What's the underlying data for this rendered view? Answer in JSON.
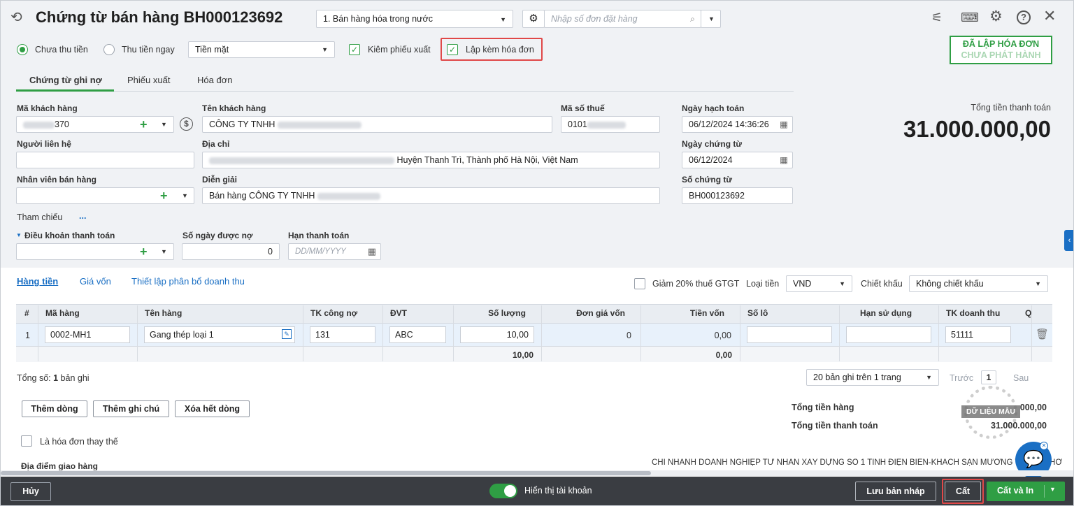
{
  "header": {
    "title": "Chứng từ bán hàng BH000123692",
    "type_select": "1. Bán hàng hóa trong nước",
    "order_placeholder": "Nhập số đơn đặt hàng"
  },
  "options": {
    "radio_unpaid": "Chưa thu tiền",
    "radio_paid": "Thu tiền ngay",
    "payment_method": "Tiền mặt",
    "chk_export": "Kiêm phiếu xuất",
    "chk_invoice": "Lập kèm hóa đơn"
  },
  "stamp": {
    "line1": "ĐÃ LẬP HÓA ĐƠN",
    "line2": "CHƯA PHÁT HÀNH"
  },
  "tabs": [
    "Chứng từ ghi nợ",
    "Phiếu xuất",
    "Hóa đơn"
  ],
  "form": {
    "customer_code_label": "Mã khách hàng",
    "customer_code_value": "370",
    "customer_name_label": "Tên khách hàng",
    "customer_name_value": "CÔNG TY TNHH",
    "tax_code_label": "Mã số thuế",
    "tax_code_value": "0101",
    "contact_label": "Người liên hệ",
    "address_label": "Địa chỉ",
    "address_value": "Huyện Thanh Trì, Thành phố Hà Nội, Việt Nam",
    "sales_staff_label": "Nhân viên bán hàng",
    "description_label": "Diễn giải",
    "description_value": "Bán hàng CÔNG TY TNHH",
    "reference_label": "Tham chiếu",
    "reference_more": "...",
    "payment_terms_label": "Điều khoản thanh toán",
    "credit_days_label": "Số ngày được nợ",
    "credit_days_value": "0",
    "due_date_label": "Hạn thanh toán",
    "due_date_placeholder": "DD/MM/YYYY",
    "posting_date_label": "Ngày hạch toán",
    "posting_date_value": "06/12/2024 14:36:26",
    "voucher_date_label": "Ngày chứng từ",
    "voucher_date_value": "06/12/2024",
    "voucher_no_label": "Số chứng từ",
    "voucher_no_value": "BH000123692"
  },
  "total": {
    "label": "Tổng tiền thanh toán",
    "value": "31.000.000,00"
  },
  "subtabs": [
    "Hàng tiền",
    "Giá vốn",
    "Thiết lập phân bổ doanh thu"
  ],
  "grid_opts": {
    "vat_reduce": "Giảm 20% thuế GTGT",
    "currency_label": "Loại tiền",
    "currency": "VND",
    "discount_label": "Chiết khấu",
    "discount": "Không chiết khấu"
  },
  "table": {
    "headers": [
      "#",
      "Mã hàng",
      "Tên hàng",
      "TK công nợ",
      "ĐVT",
      "Số lượng",
      "Đơn giá vốn",
      "Tiền vốn",
      "Số lô",
      "Hạn sử dụng",
      "TK doanh thu",
      "Q"
    ],
    "rows": [
      {
        "no": "1",
        "code": "0002-MH1",
        "name": "Gang thép loại 1",
        "account": "131",
        "unit": "ABC",
        "qty": "10,00",
        "unit_cost": "0",
        "cost": "0,00",
        "lot": "",
        "expiry": "",
        "revenue_account": "51111"
      }
    ],
    "sum_qty": "10,00",
    "sum_cost": "0,00"
  },
  "paging": {
    "count_prefix": "Tổng số: ",
    "count_num": "1",
    "count_suffix": " bản ghi",
    "page_size": "20 bản ghi trên 1 trang",
    "prev": "Trước",
    "page": "1",
    "next": "Sau"
  },
  "buttons": {
    "add_row": "Thêm dòng",
    "add_note": "Thêm ghi chú",
    "delete_all": "Xóa hết dòng"
  },
  "summary": {
    "goods_total_label": "Tổng tiền hàng",
    "goods_total_value": "000,00",
    "pay_total_label": "Tổng tiền thanh toán",
    "pay_total_value": "31.000.000,00",
    "watermark": "DỮ LIỆU MẪU"
  },
  "replacement_label": "Là hóa đơn thay thế",
  "delivery_label": "Địa điểm giao hàng",
  "branch_text": "CHI NHÁNH DOANH NGHIỆP TƯ NHÂN XÂY DỰNG SỐ 1 TỈNH ĐIỆN BIÊN-KHÁCH SẠN MƯỜNG THANH THƠ",
  "footer": {
    "cancel": "Hủy",
    "toggle_label": "Hiển thị tài khoản",
    "draft": "Lưu bản nháp",
    "save": "Cất",
    "save_print": "Cất và In"
  },
  "colors": {
    "green": "#2f9e44",
    "highlight": "#e04848",
    "link": "#1a6fc4",
    "footer": "#3a3d42"
  }
}
